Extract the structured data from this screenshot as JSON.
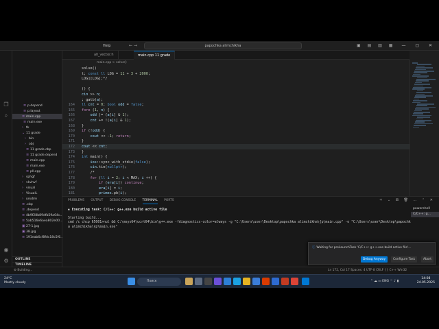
{
  "window": {
    "menu_label": "Help",
    "search_text": "papochka alimchikha",
    "nav_arrows": "← →"
  },
  "sidebar": {
    "items": [
      {
        "label": "p.depend",
        "icon": "file-icon"
      },
      {
        "label": "p.layout",
        "icon": "file-icon"
      },
      {
        "label": "main.cpp",
        "icon": "cpp-file-icon"
      },
      {
        "label": "main.exe",
        "icon": "exe-file-icon"
      },
      {
        "label": "tk",
        "icon": "chevron-right-icon"
      },
      {
        "label": "11 grade",
        "icon": "chevron-down-icon"
      },
      {
        "label": "bin",
        "icon": "chevron-right-icon"
      },
      {
        "label": "obj",
        "icon": "chevron-right-icon"
      },
      {
        "label": "11 grade.cbp",
        "icon": "file-icon"
      },
      {
        "label": "11 grade.depend",
        "icon": "file-icon"
      },
      {
        "label": "main.cpp",
        "icon": "cpp-file-icon"
      },
      {
        "label": "main.exe",
        "icon": "exe-file-icon"
      },
      {
        "label": "pll.cpp",
        "icon": "cpp-file-icon"
      },
      {
        "label": "sphgf",
        "icon": "chevron-right-icon"
      },
      {
        "label": "vkvhvf",
        "icon": "chevron-right-icon"
      },
      {
        "label": "visual",
        "icon": "chevron-right-icon"
      },
      {
        "label": "VisualL",
        "icon": "chevron-right-icon"
      },
      {
        "label": "youbro",
        "icon": "chevron-right-icon"
      },
      {
        "label": ".cbp",
        "icon": "file-icon"
      },
      {
        "label": ".depend",
        "icon": "file-icon"
      },
      {
        "label": "4b9f28b89dfb59a04c...",
        "icon": "file-icon"
      },
      {
        "label": "5ab516e6aea802e00...",
        "icon": "file-icon"
      },
      {
        "label": "27-1.jpg",
        "icon": "image-icon"
      },
      {
        "label": "38.jpg",
        "icon": "image-icon"
      },
      {
        "label": "191eab6cf8fdc18c5f6...",
        "icon": "file-icon"
      }
    ],
    "outline_label": "OUTLINE",
    "timeline_label": "TIMELINE"
  },
  "tabs": [
    {
      "label": "all_vector.h",
      "active": false
    },
    {
      "label": "main.cpp  11 grade",
      "active": true
    }
  ],
  "breadcrumb": "main.cpp > solve()",
  "editor": {
    "lines": [
      {
        "n": "",
        "code": "solve()"
      },
      {
        "n": "",
        "code": "t; const ll LOG = 11 + 3 + 2000;"
      },
      {
        "n": "",
        "code": "LOG][LOG];*/"
      },
      {
        "n": "",
        "code": ""
      },
      {
        "n": "",
        "code": "() {"
      },
      {
        "n": "",
        "code": "cin >> n;"
      },
      {
        "n": "",
        "code": "; gatb(a);"
      },
      {
        "n": "164",
        "code": "ll cnt = 0; bool odd = false;"
      },
      {
        "n": "165",
        "code": "fore (1, n) {"
      },
      {
        "n": "166",
        "code": "    odd |= (a[i] & 1);"
      },
      {
        "n": "167",
        "code": "    cnt += !(a[i] & 1);"
      },
      {
        "n": "168",
        "code": "}"
      },
      {
        "n": "169",
        "code": "if (!odd) {"
      },
      {
        "n": "170",
        "code": "    cout << -1; return;"
      },
      {
        "n": "171",
        "code": "}"
      },
      {
        "n": "172",
        "code": "cout << cnt;"
      },
      {
        "n": "173",
        "code": "}"
      },
      {
        "n": "174",
        "code": "int main() {"
      },
      {
        "n": "175",
        "code": "    ios::sync_with_stdio(false);"
      },
      {
        "n": "176",
        "code": "    cin.tie(nullptr);"
      },
      {
        "n": "177",
        "code": "    /*"
      },
      {
        "n": "178",
        "code": "    for (ll i = 2; i < MAX; i ++) {"
      },
      {
        "n": "179",
        "code": "        if (era[i]) continue;"
      },
      {
        "n": "180",
        "code": "        era[i] = i;"
      },
      {
        "n": "181",
        "code": "        primes.pb(i);"
      }
    ],
    "current_line": "172"
  },
  "panel": {
    "tabs": [
      "PROBLEMS",
      "OUTPUT",
      "DEBUG CONSOLE",
      "TERMINAL",
      "PORTS"
    ],
    "active_tab": "TERMINAL",
    "task_line": "Executing task: C/C++: g++.exe build active file",
    "output_lines": [
      "Starting build...",
      "cmd /c chcp 65001>nul && C:\\msys64\\ucrt64\\bin\\g++.exe -fdiagnostics-color=always -g \"C:\\Users\\user\\Desktop\\papochka alimchikha\\{p\\main.cpp\" -o \"C:\\Users\\user\\Desktop\\papochka alimchikha\\{p\\main.exe\""
    ],
    "terminals": [
      "powershell",
      "C/C++: g..."
    ]
  },
  "notification": {
    "message": "Waiting for preLaunchTask 'C/C++: g++.exe build active file'...",
    "buttons": [
      "Debug Anyway",
      "Configure Task",
      "Abort"
    ]
  },
  "statusbar": {
    "left": "⚙ Building...",
    "right": "Ln 172, Col 17   Spaces: 4   UTF-8   CRLF   {} C++   Win32"
  },
  "taskbar": {
    "weather_temp": "24°C",
    "weather_desc": "Mostly cloudy",
    "search_label": "Поиск",
    "lang": "ENG",
    "time": "14:08",
    "date": "24.05.2025"
  },
  "colors": {
    "accent": "#0078d4",
    "editor_bg": "#1f1f1f",
    "taskbar_bg": "#1c2738"
  }
}
